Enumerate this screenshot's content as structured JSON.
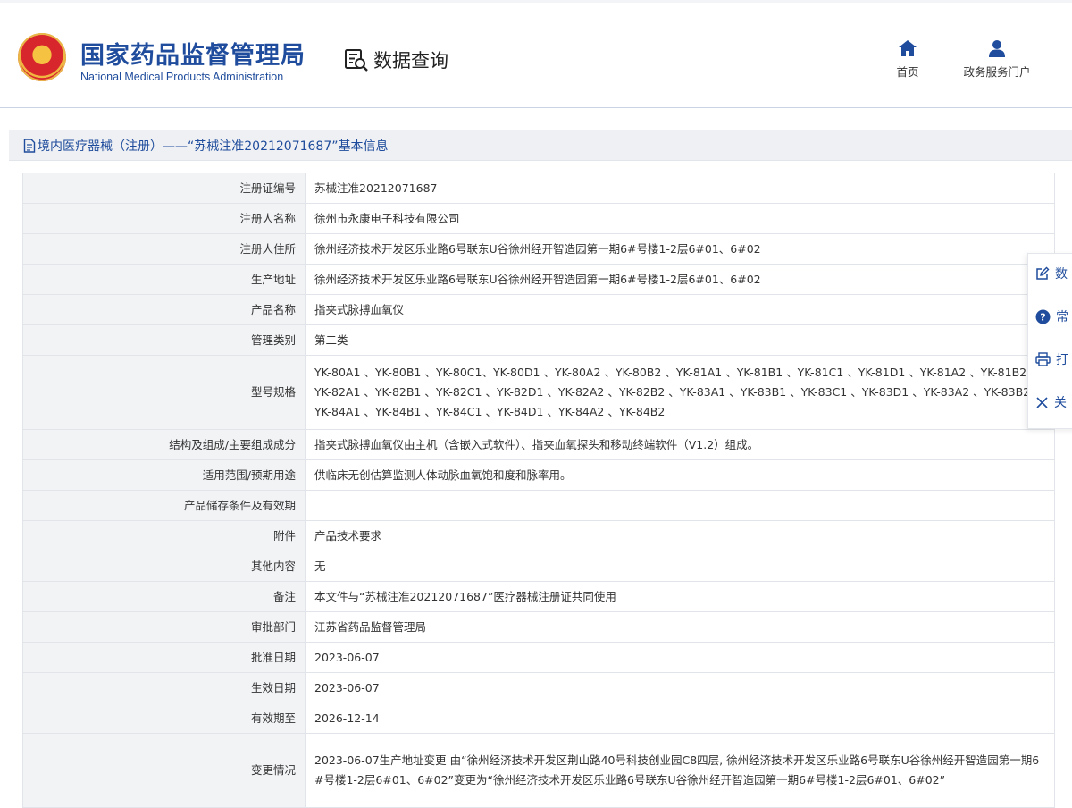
{
  "header": {
    "org_name_cn": "国家药品监督管理局",
    "org_name_en": "National Medical Products Administration",
    "page_title": "数据查询",
    "nav": [
      {
        "label": "首页",
        "icon": "home-icon"
      },
      {
        "label": "政务服务门户",
        "icon": "user-icon"
      }
    ]
  },
  "section": {
    "title": "境内医疗器械（注册）——“苏械注准20212071687”基本信息",
    "icon": "document-icon"
  },
  "details": [
    {
      "label": "注册证编号",
      "value": "苏械注准20212071687"
    },
    {
      "label": "注册人名称",
      "value": "徐州市永康电子科技有限公司"
    },
    {
      "label": "注册人住所",
      "value": "徐州经济技术开发区乐业路6号联东U谷徐州经开智造园第一期6#号楼1-2层6#01、6#02"
    },
    {
      "label": "生产地址",
      "value": "徐州经济技术开发区乐业路6号联东U谷徐州经开智造园第一期6#号楼1-2层6#01、6#02"
    },
    {
      "label": "产品名称",
      "value": "指夹式脉搏血氧仪"
    },
    {
      "label": "管理类别",
      "value": "第二类"
    },
    {
      "label": "型号规格",
      "value": "YK-80A1 、YK-80B1 、YK-80C1、YK-80D1 、YK-80A2 、YK-80B2 、YK-81A1 、YK-81B1 、YK-81C1 、YK-81D1 、YK-81A2 、YK-81B2 、YK-82A1 、YK-82B1 、YK-82C1 、YK-82D1 、YK-82A2 、YK-82B2 、YK-83A1 、YK-83B1 、YK-83C1 、YK-83D1 、YK-83A2 、YK-83B2 、YK-84A1 、YK-84B1 、YK-84C1 、YK-84D1 、YK-84A2 、YK-84B2"
    },
    {
      "label": "结构及组成/主要组成成分",
      "value": "指夹式脉搏血氧仪由主机（含嵌入式软件）、指夹血氧探头和移动终端软件（V1.2）组成。"
    },
    {
      "label": "适用范围/预期用途",
      "value": "供临床无创估算监测人体动脉血氧饱和度和脉率用。"
    },
    {
      "label": "产品储存条件及有效期",
      "value": ""
    },
    {
      "label": "附件",
      "value": "产品技术要求"
    },
    {
      "label": "其他内容",
      "value": "无"
    },
    {
      "label": "备注",
      "value": "本文件与“苏械注准20212071687”医疗器械注册证共同使用"
    },
    {
      "label": "审批部门",
      "value": "江苏省药品监督管理局"
    },
    {
      "label": "批准日期",
      "value": "2023-06-07"
    },
    {
      "label": "生效日期",
      "value": "2023-06-07"
    },
    {
      "label": "有效期至",
      "value": "2026-12-14"
    },
    {
      "label": "变更情况",
      "value": "2023-06-07生产地址变更 由“徐州经济技术开发区荆山路40号科技创业园C8四层, 徐州经济技术开发区乐业路6号联东U谷徐州经开智造园第一期6#号楼1-2层6#01、6#02”变更为“徐州经济技术开发区乐业路6号联东U谷徐州经开智造园第一期6#号楼1-2层6#01、6#02”"
    }
  ],
  "float_panel": [
    {
      "label": "数",
      "icon": "edit-icon"
    },
    {
      "label": "常",
      "icon": "question-icon"
    },
    {
      "label": "打",
      "icon": "print-icon"
    },
    {
      "label": "关",
      "icon": "close-icon"
    }
  ],
  "colors": {
    "brand_blue": "#1f4c9c",
    "label_bg": "#f2f3f5",
    "border": "#e1e4e8"
  }
}
